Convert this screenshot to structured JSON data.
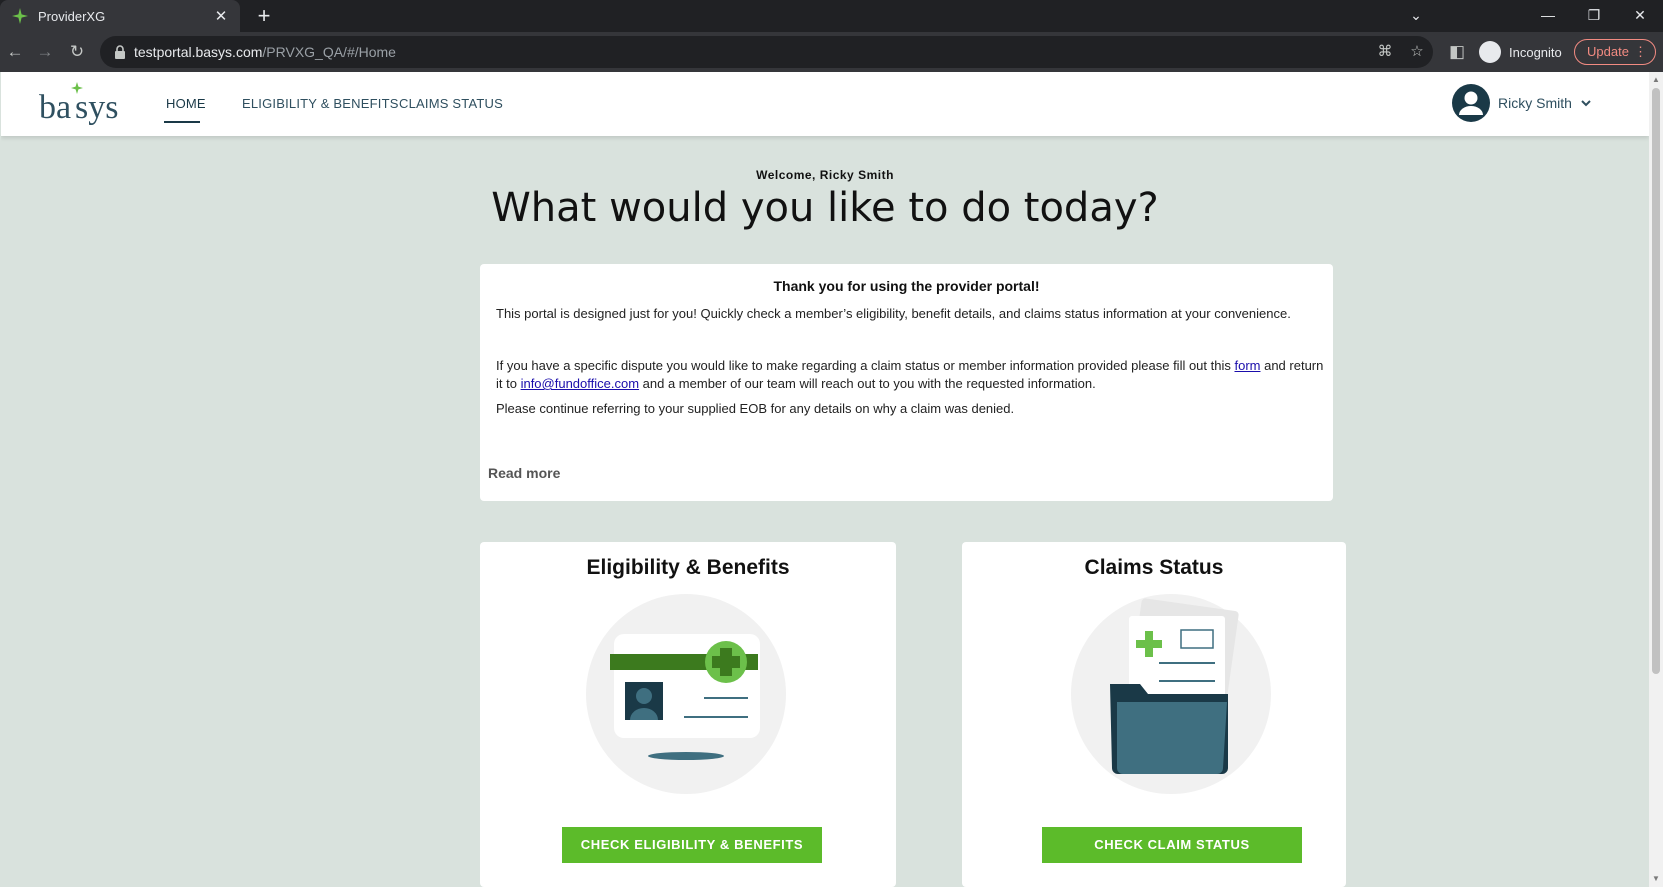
{
  "browser": {
    "tab_title": "ProviderXG",
    "url_host": "testportal.basys.com",
    "url_path": "/PRVXG_QA/#/Home",
    "incognito_label": "Incognito",
    "update_label": "Update"
  },
  "app": {
    "logo_text": "basys",
    "nav": [
      {
        "label": "HOME"
      },
      {
        "label": "ELIGIBILITY & BENEFITS"
      },
      {
        "label": "CLAIMS STATUS"
      }
    ],
    "user_name": "Ricky Smith"
  },
  "hero": {
    "welcome": "Welcome, Ricky Smith",
    "headline": "What would you like to do today?"
  },
  "notice": {
    "title": "Thank you for using the provider portal!",
    "para1": "This portal is designed just for you! Quickly check a member’s eligibility, benefit details, and claims status information at your convenience.",
    "para2_before": "If you have a specific dispute you would like to make regarding a claim status or member information provided please fill out this ",
    "para2_link": "form",
    "para2_middle": " and return it to ",
    "para2_email": "info@fundoffice.com",
    "para2_after": " and a member of our team will reach out to you with the requested information.",
    "para3": "Please continue referring to your supplied EOB for any details on why a claim was denied.",
    "read_more": "Read more"
  },
  "cards": [
    {
      "title": "Eligibility & Benefits",
      "button": "CHECK ELIGIBILITY & BENEFITS"
    },
    {
      "title": "Claims Status",
      "button": "CHECK CLAIM STATUS"
    }
  ],
  "colors": {
    "accent_green": "#5cbb2a",
    "navy": "#1a3947",
    "page_bg": "#d9e2dd"
  }
}
